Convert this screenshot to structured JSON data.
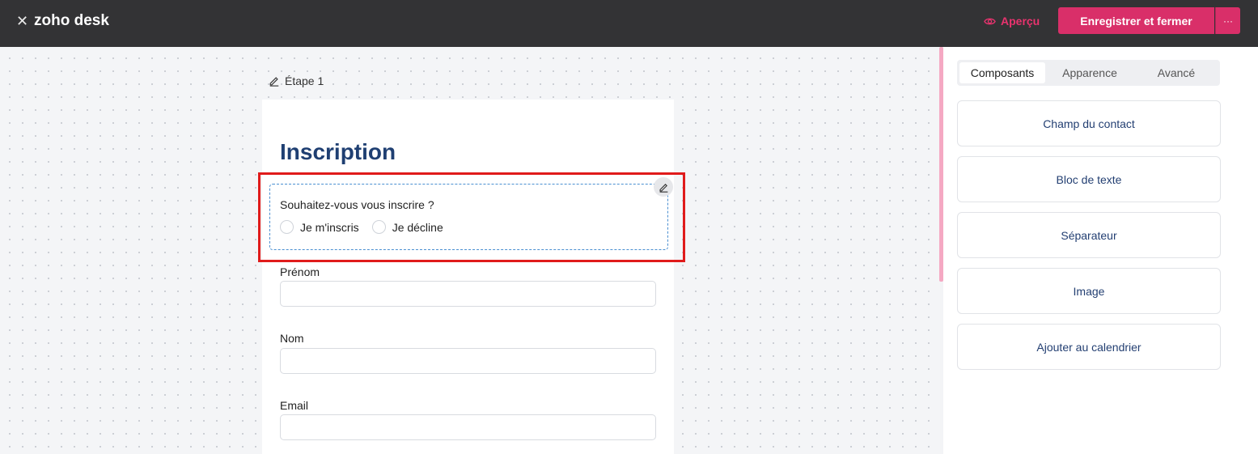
{
  "header": {
    "app_title": "zoho desk",
    "preview_label": "Aperçu",
    "save_close_label": "Enregistrer et fermer",
    "more_label": "···"
  },
  "canvas": {
    "step_label": "Étape 1"
  },
  "form": {
    "title": "Inscription",
    "radio_question": "Souhaitez-vous vous inscrire ?",
    "radio_options": [
      "Je m'inscris",
      "Je décline"
    ],
    "fields": [
      {
        "label": "Prénom",
        "value": ""
      },
      {
        "label": "Nom",
        "value": ""
      },
      {
        "label": "Email",
        "value": ""
      }
    ]
  },
  "panel": {
    "tabs": [
      {
        "label": "Composants",
        "active": true
      },
      {
        "label": "Apparence",
        "active": false
      },
      {
        "label": "Avancé",
        "active": false
      }
    ],
    "components": [
      "Champ du contact",
      "Bloc de texte",
      "Séparateur",
      "Image",
      "Ajouter au calendrier"
    ]
  },
  "colors": {
    "accent": "#d92f69",
    "title_blue": "#1f3f72",
    "selection_dash": "#4a8fd1",
    "highlight_red": "#e01b1b"
  }
}
